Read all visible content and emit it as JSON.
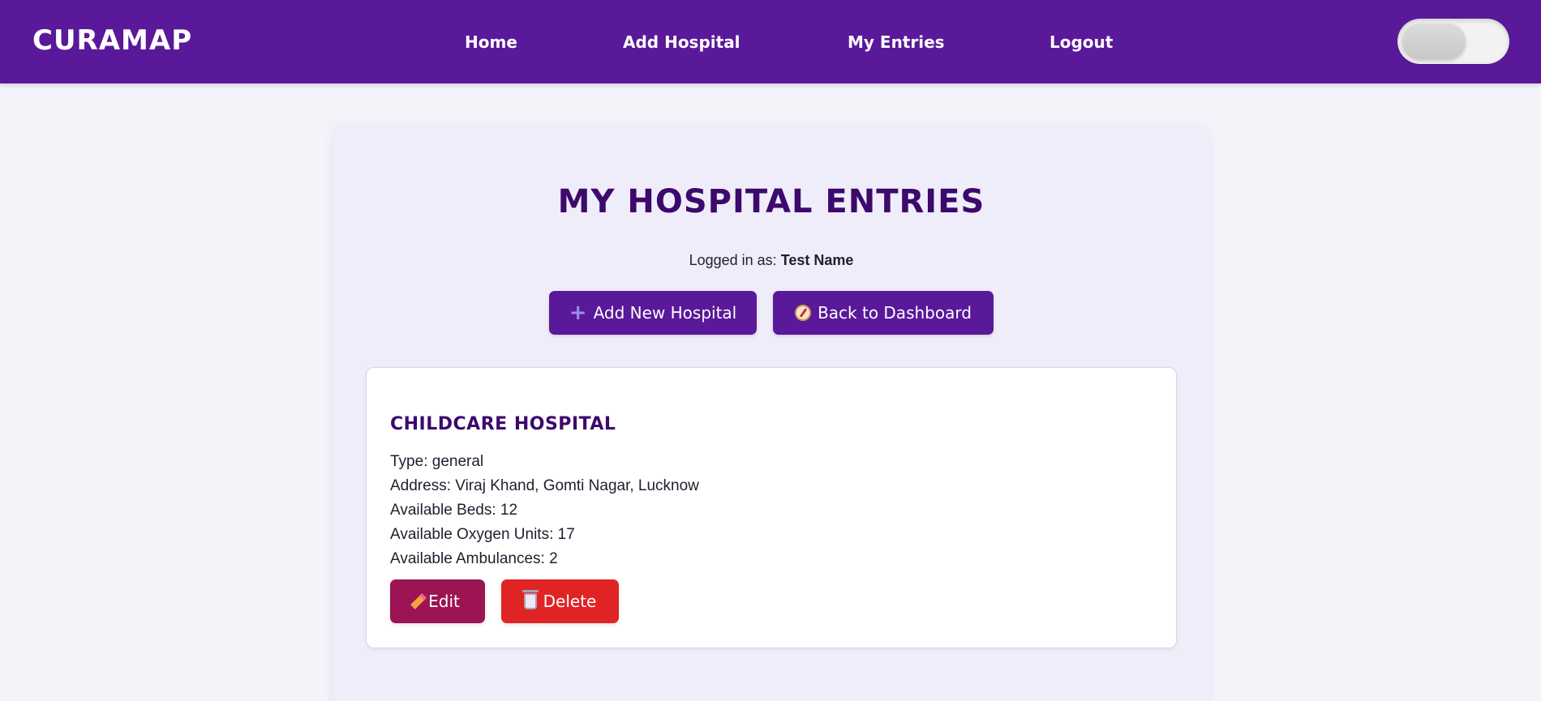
{
  "navbar": {
    "brand": "CURAMAP",
    "links": {
      "home": "Home",
      "add_hospital": "Add Hospital",
      "my_entries": "My Entries",
      "logout": "Logout"
    },
    "theme_toggle": {
      "state": "off"
    }
  },
  "main": {
    "title": "MY HOSPITAL ENTRIES",
    "logged_in_prefix": "Logged in as:",
    "user_name": "Test Name",
    "buttons": {
      "add_new": "Add New Hospital",
      "back_dashboard": "Back to Dashboard"
    },
    "entries": [
      {
        "name": "CHILDCARE HOSPITAL",
        "type": "Type: general",
        "address": "Address: Viraj Khand, Gomti Nagar, Lucknow",
        "beds": "Available Beds: 12",
        "oxygen": "Available Oxygen Units: 17",
        "ambulances": "Available Ambulances: 2",
        "edit_label": "Edit",
        "delete_label": "Delete"
      }
    ]
  },
  "colors": {
    "navbar": "#5a189a",
    "title": "#3c096c",
    "edit_button": "#9c1453",
    "delete_button": "#e02424",
    "page_background": "#f4f3fa",
    "card_background": "#efedf9"
  },
  "icons": {
    "add": "plus-icon",
    "dashboard": "compass-icon",
    "edit": "pencil-icon",
    "delete": "trash-icon"
  }
}
